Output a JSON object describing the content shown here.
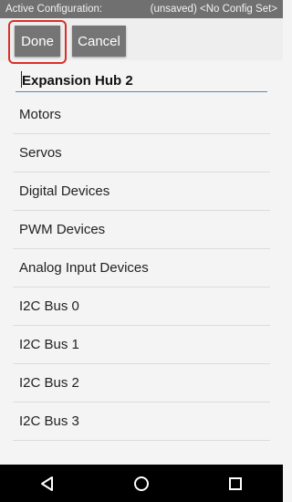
{
  "status_bar": {
    "label": "Active Configuration:",
    "config": "(unsaved) <No Config Set>"
  },
  "toolbar": {
    "done_label": "Done",
    "cancel_label": "Cancel"
  },
  "device_name": {
    "value": "Expansion Hub 2"
  },
  "menu_items": [
    {
      "label": "Motors"
    },
    {
      "label": "Servos"
    },
    {
      "label": "Digital Devices"
    },
    {
      "label": "PWM Devices"
    },
    {
      "label": "Analog Input Devices"
    },
    {
      "label": "I2C Bus 0"
    },
    {
      "label": "I2C Bus 1"
    },
    {
      "label": "I2C Bus 2"
    },
    {
      "label": "I2C Bus 3"
    }
  ],
  "colors": {
    "highlight": "#d9302b",
    "button_bg": "#757575",
    "status_bg": "#707070",
    "field_underline": "#4a90c2"
  },
  "navigation": {
    "icons": [
      "back-icon",
      "home-icon",
      "recents-icon"
    ]
  }
}
